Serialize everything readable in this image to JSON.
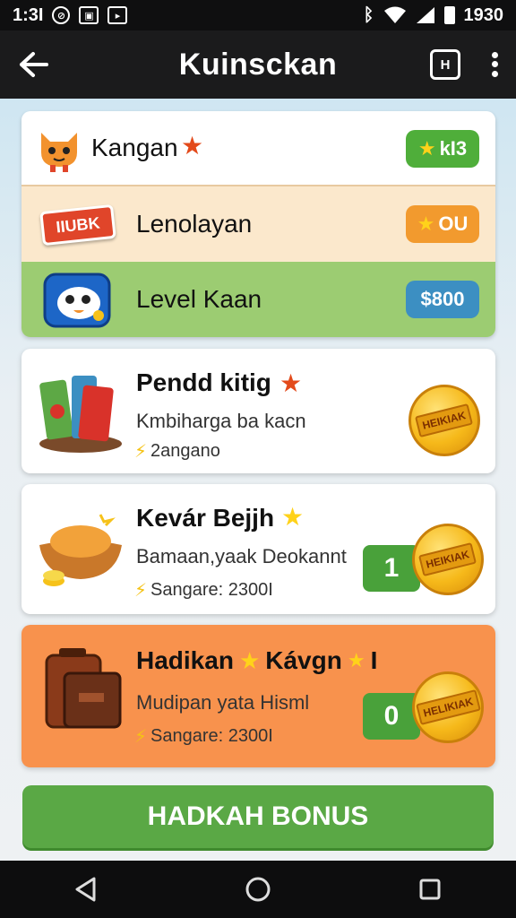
{
  "status_bar": {
    "left_time": "1:3I",
    "right_time": "1930",
    "icons": [
      "circle-icon",
      "box-icon",
      "media-icon",
      "bluetooth-icon",
      "wifi-icon",
      "signal-icon",
      "battery-icon"
    ]
  },
  "app_bar": {
    "title": "Kuinsckan",
    "square_label": "H"
  },
  "top_rows": [
    {
      "label": "Kangan",
      "icon": "cat-mascot-icon",
      "badge": "kI3",
      "badge_color": "#4fae3a"
    },
    {
      "label": "Lenolayan",
      "icon": "ribbon-label-icon",
      "icon_text": "IIUBK",
      "badge": "OU",
      "badge_color": "#f29a2e"
    },
    {
      "label": "Level Kaan",
      "icon": "monster-face-icon",
      "badge": "$800",
      "badge_color": "#3c8fc2"
    }
  ],
  "quests": [
    {
      "title": "Pendd kitig",
      "subtitle": "Kmbiharga ba kacn",
      "meta": "2angano",
      "icon": "snack-basket-icon",
      "coin_label": "HEIKIAK"
    },
    {
      "title": "Kevár Bejjh",
      "subtitle": "Bamaan,yaak Deokannt",
      "meta": "Sangare: 2300I",
      "count": "1",
      "icon": "food-bowl-icon",
      "coin_label": "HEIKIAK"
    },
    {
      "title": "Hadikan",
      "title_suffix": "Kávgn",
      "title_end": "I",
      "subtitle": "Mudipan yata Hisml",
      "meta": "Sangare: 2300I",
      "count": "0",
      "icon": "suitcase-icon",
      "coin_label": "HELIKIAK"
    }
  ],
  "bonus_button": "HADKAH BONUS",
  "colors": {
    "accent_green": "#5aa845",
    "orange_card": "#f8924d",
    "dark_bar": "#1b1b1c"
  }
}
